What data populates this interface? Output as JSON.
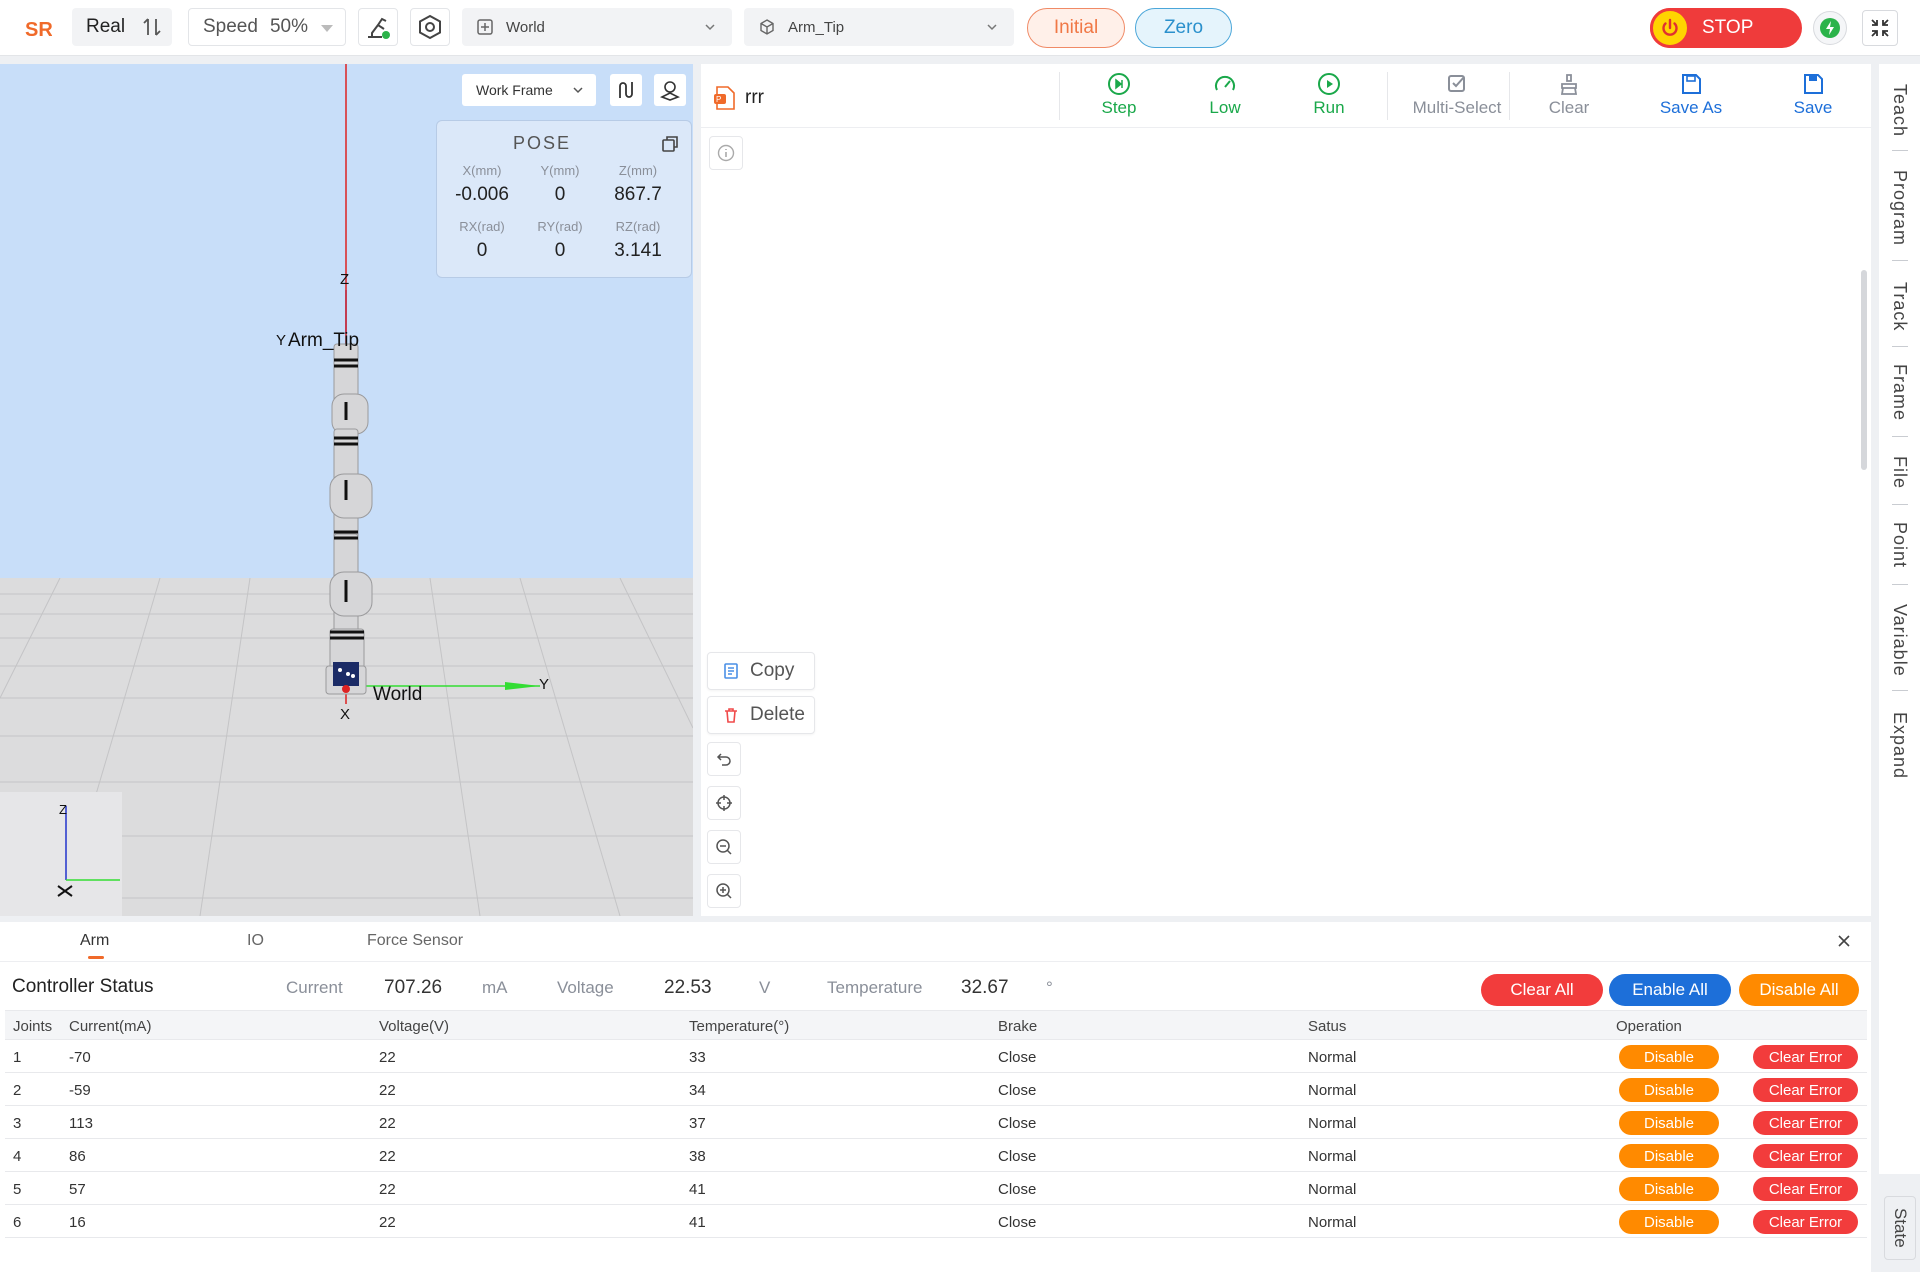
{
  "toolbar": {
    "mode": "Real",
    "speed_label": "Speed",
    "speed_value": "50%",
    "frame_select": "World",
    "tool_select": "Arm_Tip",
    "initial_label": "Initial",
    "zero_label": "Zero",
    "stop_label": "STOP"
  },
  "viewport": {
    "frame_select": "Work Frame",
    "pose": {
      "title": "POSE",
      "labels": [
        "X(mm)",
        "Y(mm)",
        "Z(mm)",
        "RX(rad)",
        "RY(rad)",
        "RZ(rad)"
      ],
      "values": [
        "-0.006",
        "0",
        "867.7",
        "0",
        "0",
        "3.141"
      ]
    },
    "labels": {
      "tool_y": "Y",
      "tool_name": "Arm_Tip",
      "tool_z": "Z",
      "world": "World",
      "world_y": "Y",
      "world_x": "X",
      "mini_z": "Z"
    }
  },
  "program": {
    "file_name": "rrr",
    "tools": {
      "step": "Step",
      "low": "Low",
      "run": "Run",
      "multi_select": "Multi-Select",
      "clear": "Clear",
      "save_as": "Save As",
      "save": "Save"
    },
    "context": {
      "copy": "Copy",
      "delete": "Delete"
    }
  },
  "right_nav": [
    "Teach",
    "Program",
    "Track",
    "Frame",
    "File",
    "Point",
    "Variable",
    "Expand"
  ],
  "state_tab": "State",
  "status_panel": {
    "tabs": [
      "Arm",
      "IO",
      "Force Sensor"
    ],
    "controller_title": "Controller Status",
    "current_label": "Current",
    "current_value": "707.26",
    "current_unit": "mA",
    "voltage_label": "Voltage",
    "voltage_value": "22.53",
    "voltage_unit": "V",
    "temp_label": "Temperature",
    "temp_value": "32.67",
    "temp_unit": "°",
    "clear_all": "Clear All",
    "enable_all": "Enable All",
    "disable_all": "Disable All",
    "columns": [
      "Joints",
      "Current(mA)",
      "Voltage(V)",
      "Temperature(°)",
      "Brake",
      "Satus",
      "Operation"
    ],
    "rows": [
      {
        "joint": "1",
        "current": "-70",
        "voltage": "22",
        "temp": "33",
        "brake": "Close",
        "status": "Normal"
      },
      {
        "joint": "2",
        "current": "-59",
        "voltage": "22",
        "temp": "34",
        "brake": "Close",
        "status": "Normal"
      },
      {
        "joint": "3",
        "current": "113",
        "voltage": "22",
        "temp": "37",
        "brake": "Close",
        "status": "Normal"
      },
      {
        "joint": "4",
        "current": "86",
        "voltage": "22",
        "temp": "38",
        "brake": "Close",
        "status": "Normal"
      },
      {
        "joint": "5",
        "current": "57",
        "voltage": "22",
        "temp": "41",
        "brake": "Close",
        "status": "Normal"
      },
      {
        "joint": "6",
        "current": "16",
        "voltage": "22",
        "temp": "41",
        "brake": "Close",
        "status": "Normal"
      }
    ],
    "disable_label": "Disable",
    "clear_error_label": "Clear Error"
  },
  "colors": {
    "accent_orange": "#f06a2a",
    "stop_red": "#ef3b3b",
    "run_green": "#1aa84a",
    "save_blue": "#1d6fd9",
    "disable_orange": "#ff8a00",
    "clear_red": "#f23c3c"
  }
}
